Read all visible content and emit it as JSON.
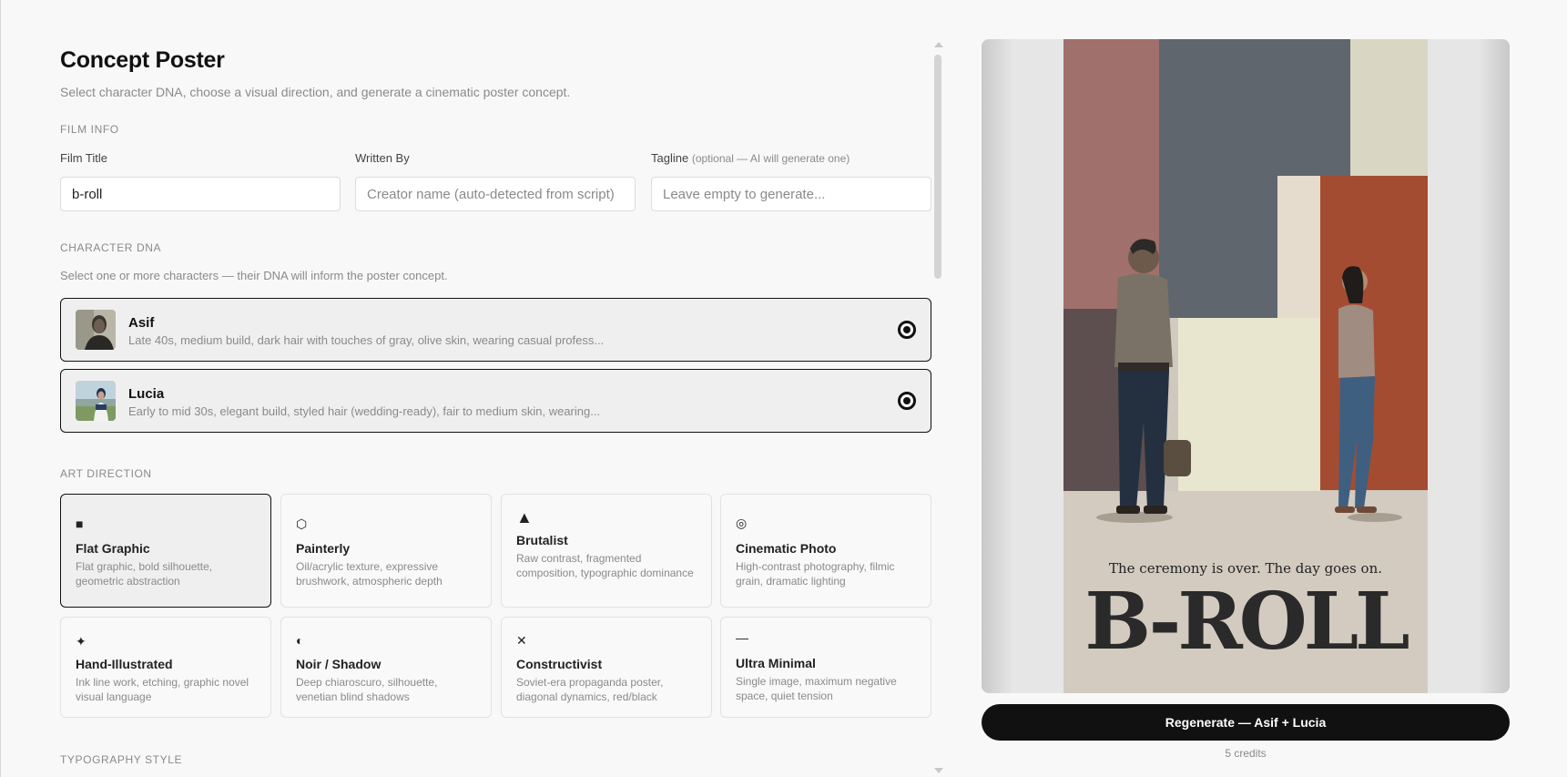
{
  "page": {
    "title": "Concept Poster",
    "subtitle": "Select character DNA, choose a visual direction, and generate a cinematic poster concept."
  },
  "film_info": {
    "section_label": "FILM INFO",
    "title_label": "Film Title",
    "title_value": "b-roll",
    "written_by_label": "Written By",
    "written_by_placeholder": "Creator name (auto-detected from script)",
    "tagline_label": "Tagline",
    "tagline_hint": "(optional — AI will generate one)",
    "tagline_placeholder": "Leave empty to generate..."
  },
  "character_dna": {
    "section_label": "CHARACTER DNA",
    "hint": "Select one or more characters — their DNA will inform the poster concept.",
    "characters": [
      {
        "name": "Asif",
        "description": "Late 40s, medium build, dark hair with touches of gray, olive skin, wearing casual profess...",
        "selected": true
      },
      {
        "name": "Lucia",
        "description": "Early to mid 30s, elegant build, styled hair (wedding-ready), fair to medium skin, wearing...",
        "selected": true
      }
    ]
  },
  "art_direction": {
    "section_label": "ART DIRECTION",
    "styles": [
      {
        "icon": "■",
        "icon_name": "square-icon",
        "name": "Flat Graphic",
        "description": "Flat graphic, bold silhouette, geometric abstraction",
        "selected": true
      },
      {
        "icon": "⬡",
        "icon_name": "hexagon-icon",
        "name": "Painterly",
        "description": "Oil/acrylic texture, expressive brushwork, atmospheric depth",
        "selected": false
      },
      {
        "icon": "▲",
        "icon_name": "triangle-icon",
        "name": "Brutalist",
        "description": "Raw contrast, fragmented composition, typographic dominance",
        "selected": false
      },
      {
        "icon": "◎",
        "icon_name": "target-icon",
        "name": "Cinematic Photo",
        "description": "High-contrast photography, filmic grain, dramatic lighting",
        "selected": false
      },
      {
        "icon": "✦",
        "icon_name": "sparkle-icon",
        "name": "Hand-Illustrated",
        "description": "Ink line work, etching, graphic novel visual language",
        "selected": false
      },
      {
        "icon": "◐",
        "icon_name": "half-circle-icon",
        "name": "Noir / Shadow",
        "description": "Deep chiaroscuro, silhouette, venetian blind shadows",
        "selected": false
      },
      {
        "icon": "✕",
        "icon_name": "cross-icon",
        "name": "Constructivist",
        "description": "Soviet-era propaganda poster, diagonal dynamics, red/black",
        "selected": false
      },
      {
        "icon": "—",
        "icon_name": "dash-icon",
        "name": "Ultra Minimal",
        "description": "Single image, maximum negative space, quiet tension",
        "selected": false
      }
    ]
  },
  "typography": {
    "section_label": "TYPOGRAPHY STYLE"
  },
  "poster": {
    "tagline": "The ceremony is over. The day goes on.",
    "title": "B-ROLL"
  },
  "actions": {
    "regenerate_label": "Regenerate — Asif + Lucia",
    "credits_label": "5 credits"
  },
  "colors": {
    "accent": "#111111",
    "muted_text": "#8a8a8a",
    "poster_rose": "#a0706c",
    "poster_slate": "#5f666d",
    "poster_cream": "#e8e6cf",
    "poster_rust": "#a44c32"
  }
}
